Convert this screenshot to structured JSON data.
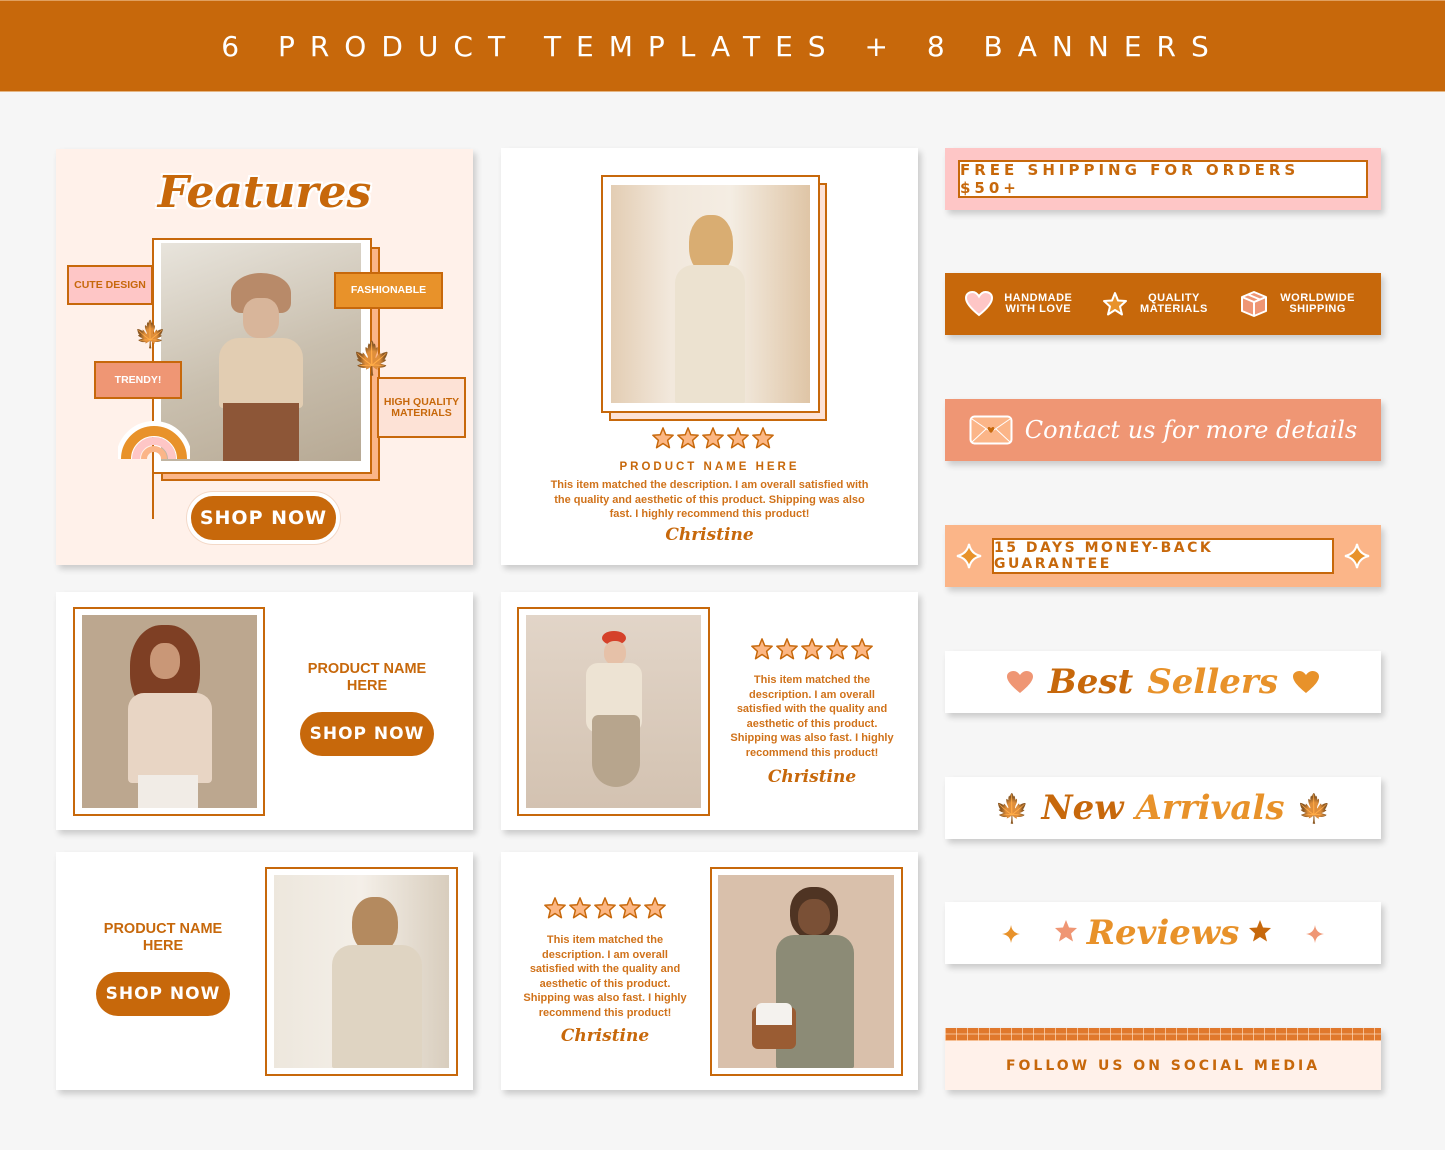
{
  "header": {
    "title": "6 PRODUCT TEMPLATES + 8 BANNERS"
  },
  "colors": {
    "primary": "#c7680b",
    "orange": "#e8922a",
    "salmon": "#ef9674",
    "peach": "#fbb588",
    "pink": "#fec6c6",
    "cream": "#fff1ea",
    "background": "#f6f6f6",
    "star_fill": "#fcb784"
  },
  "templates": {
    "features": {
      "title": "Features",
      "labels": [
        "CUTE DESIGN",
        "FASHIONABLE",
        "TRENDY!",
        "HIGH QUALITY MATERIALS"
      ],
      "button": "SHOP NOW"
    },
    "review_square": {
      "rating": 5,
      "product_name": "PRODUCT NAME HERE",
      "review": "This item matched the description. I am overall satisfied with the quality and aesthetic of this product. Shipping was also fast. I highly recommend this product!",
      "reviewer": "Christine"
    },
    "product_left": {
      "product_name": "PRODUCT NAME HERE",
      "button": "SHOP NOW"
    },
    "review_right": {
      "rating": 5,
      "review": "This item matched the description. I am overall satisfied with the quality and aesthetic of this product. Shipping was also fast. I highly recommend this product!",
      "reviewer": "Christine"
    },
    "product_right": {
      "product_name": "PRODUCT NAME HERE",
      "button": "SHOP NOW"
    },
    "review_left": {
      "rating": 5,
      "review": "This item matched the description. I am overall satisfied with the quality and aesthetic of this product. Shipping was also fast. I highly recommend this product!",
      "reviewer": "Christine"
    }
  },
  "banners": {
    "free_shipping": "FREE SHIPPING FOR ORDERS $50+",
    "features": [
      {
        "icon": "heart-icon",
        "label": "HANDMADE WITH LOVE"
      },
      {
        "icon": "star-icon",
        "label": "QUALITY MATERIALS"
      },
      {
        "icon": "box-icon",
        "label": "WORLDWIDE SHIPPING"
      }
    ],
    "contact": "Contact us for more details",
    "guarantee": "15 DAYS MONEY-BACK GUARANTEE",
    "best_sellers": {
      "word1": "Best",
      "word2": "Sellers"
    },
    "new_arrivals": {
      "word1": "New",
      "word2": "Arrivals"
    },
    "reviews": "Reviews",
    "social": "FOLLOW US ON SOCIAL MEDIA"
  }
}
